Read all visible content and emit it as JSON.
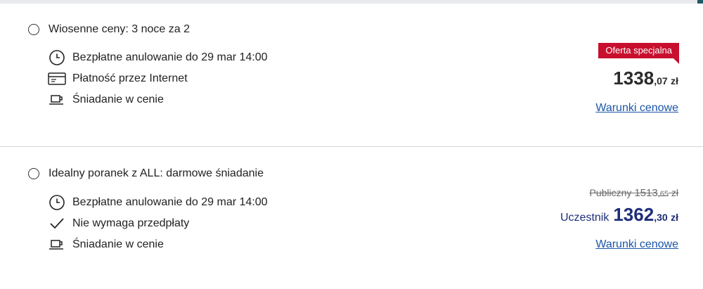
{
  "offers": [
    {
      "title": "Wiosenne ceny: 3 noce za 2",
      "features": [
        {
          "icon": "clock-icon",
          "text": "Bezpłatne anulowanie do 29 mar 14:00"
        },
        {
          "icon": "credit-card-icon",
          "text": "Płatność przez Internet"
        },
        {
          "icon": "coffee-cup-icon",
          "text": "Śniadanie w cenie"
        }
      ],
      "badge": "Oferta specjalna",
      "price": {
        "integer": "1338",
        "decimal": ",07",
        "currency": "zł"
      },
      "link": "Warunki cenowe"
    },
    {
      "title": "Idealny poranek z ALL: darmowe śniadanie",
      "features": [
        {
          "icon": "clock-icon",
          "text": "Bezpłatne anulowanie do 29 mar 14:00"
        },
        {
          "icon": "checkmark-icon",
          "text": "Nie wymaga przedpłaty"
        },
        {
          "icon": "coffee-cup-icon",
          "text": "Śniadanie w cenie"
        }
      ],
      "public_price": {
        "label": "Publiczny",
        "integer": "1513",
        "decimal": ",65",
        "currency": "zł"
      },
      "member_price": {
        "label": "Uczestnik",
        "integer": "1362",
        "decimal": ",30",
        "currency": "zł"
      },
      "link": "Warunki cenowe"
    }
  ],
  "colors": {
    "badge": "#c8102e",
    "member_price": "#1d2e7a",
    "link": "#1a56a8",
    "divider": "#d6d8db"
  }
}
